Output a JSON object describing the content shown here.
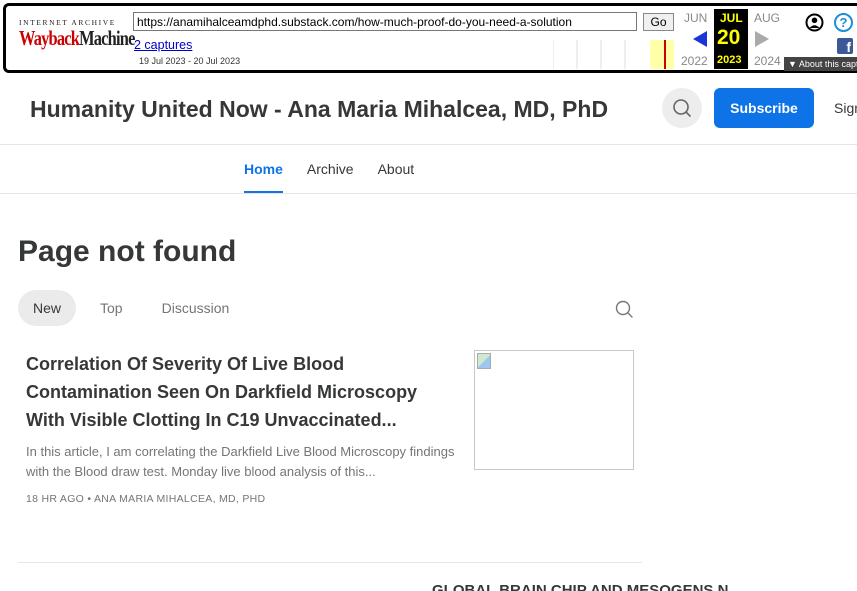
{
  "wayback": {
    "ia_label": "INTERNET ARCHIVE",
    "logo_part1": "Wayback",
    "logo_part2": "Machine",
    "url": "https://anamihalceamdphd.substack.com/how-much-proof-do-you-need-a-solution",
    "go_label": "Go",
    "captures_label": "2 captures",
    "date_range": "19 Jul 2023 - 20 Jul 2023",
    "month_prev": "JUN",
    "month_current": "JUL",
    "month_next": "AUG",
    "day": "20",
    "year_prev": "2022",
    "year_current": "2023",
    "year_next": "2024",
    "about_label": "▼ About this capture",
    "icons": [
      "user-icon",
      "help-icon",
      "facebook-icon",
      "prev-arrow-icon",
      "next-arrow-icon"
    ]
  },
  "header": {
    "title": "Humanity United Now - Ana Maria Mihalcea, MD, PhD",
    "subscribe_label": "Subscribe",
    "signin_label": "Sign in"
  },
  "nav": [
    {
      "label": "Home",
      "active": true
    },
    {
      "label": "Archive",
      "active": false
    },
    {
      "label": "About",
      "active": false
    }
  ],
  "page_heading": "Page not found",
  "tabs": [
    {
      "label": "New",
      "active": true
    },
    {
      "label": "Top",
      "active": false
    },
    {
      "label": "Discussion",
      "active": false
    }
  ],
  "posts": [
    {
      "title": "Correlation Of Severity Of Live Blood Contamination Seen On Darkfield Microscopy With Visible Clotting In C19 Unvaccinated...",
      "excerpt": "In this article, I am correlating the Darkfield Live Blood Microscopy findings with the Blood draw test. Monday live blood analysis of this...",
      "meta": "18 HR AGO • ANA MARIA MIHALCEA, MD, PHD"
    },
    {
      "title": "GLOBAL BRAIN CHIP AND MESOGENS N"
    }
  ],
  "colors": {
    "accent": "#0e73e6",
    "wayback_red": "#cc0000",
    "wayback_yellow": "#ffff00"
  }
}
